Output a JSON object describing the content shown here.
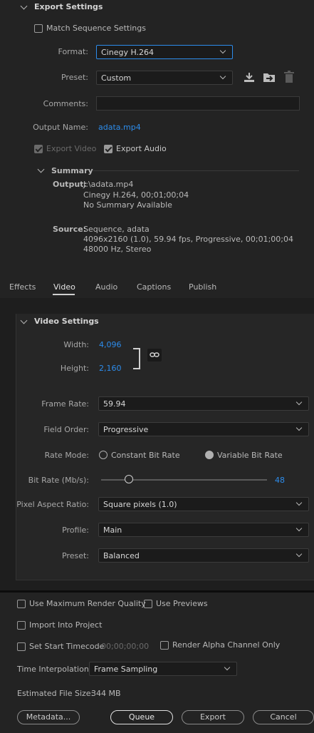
{
  "export_settings": {
    "header": "Export Settings",
    "match_sequence_label": "Match Sequence Settings",
    "format_label": "Format:",
    "format_value": "Cinegy H.264",
    "preset_label": "Preset:",
    "preset_value": "Custom",
    "comments_label": "Comments:",
    "comments_value": "",
    "output_name_label": "Output Name:",
    "output_name_value": "adata.mp4",
    "export_video_label": "Export Video",
    "export_video_checked": true,
    "export_audio_label": "Export Audio",
    "export_audio_checked": true,
    "icons": [
      "save-preset-icon",
      "import-preset-icon",
      "delete-preset-icon"
    ]
  },
  "summary": {
    "header": "Summary",
    "output_label": "Output:",
    "output_lines": [
      "J:\\adata.mp4",
      "Cinegy H.264, 00;01;00;04",
      "No Summary Available"
    ],
    "source_label": "Source:",
    "source_lines": [
      "Sequence, adata",
      "4096x2160 (1.0), 59.94 fps, Progressive, 00;01;00;04",
      "48000 Hz, Stereo"
    ]
  },
  "tabs": [
    {
      "label": "Effects",
      "active": false
    },
    {
      "label": "Video",
      "active": true
    },
    {
      "label": "Audio",
      "active": false
    },
    {
      "label": "Captions",
      "active": false
    },
    {
      "label": "Publish",
      "active": false
    }
  ],
  "video_settings": {
    "header": "Video Settings",
    "width_label": "Width:",
    "width_value": "4,096",
    "height_label": "Height:",
    "height_value": "2,160",
    "frame_rate_label": "Frame Rate:",
    "frame_rate_value": "59.94",
    "field_order_label": "Field Order:",
    "field_order_value": "Progressive",
    "rate_mode_label": "Rate Mode:",
    "rate_mode_options": [
      "Constant Bit Rate",
      "Variable Bit Rate"
    ],
    "rate_mode_selected": "Variable Bit Rate",
    "bit_rate_label": "Bit Rate (Mb/s):",
    "bit_rate_value": "48",
    "pixel_aspect_label": "Pixel Aspect Ratio:",
    "pixel_aspect_value": "Square pixels (1.0)",
    "profile_label": "Profile:",
    "profile_value": "Main",
    "preset_label": "Preset:",
    "preset_value": "Balanced"
  },
  "bottom": {
    "max_render_label": "Use Maximum Render Quality",
    "use_previews_label": "Use Previews",
    "import_project_label": "Import Into Project",
    "set_start_tc_label": "Set Start Timecode",
    "start_tc_value": "00;00;00;00",
    "render_alpha_label": "Render Alpha Channel Only",
    "time_interp_label": "Time Interpolation:",
    "time_interp_value": "Frame Sampling",
    "est_size_label": "Estimated File Size:",
    "est_size_value": "344 MB",
    "buttons": {
      "metadata": "Metadata...",
      "queue": "Queue",
      "export": "Export",
      "cancel": "Cancel"
    }
  },
  "colors": {
    "accent": "#2d8ceb",
    "bg": "#232323",
    "text": "#b9b9b9"
  }
}
